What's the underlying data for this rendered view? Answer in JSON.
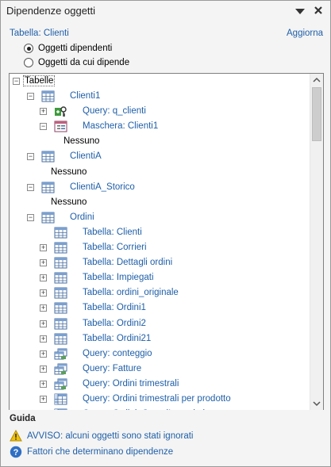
{
  "pane": {
    "title": "Dipendenze oggetti",
    "header_object": "Tabella: Clienti",
    "refresh_label": "Aggiorna"
  },
  "radios": [
    {
      "label": "Oggetti dipendenti",
      "selected": true
    },
    {
      "label": "Oggetti da cui dipende",
      "selected": false
    }
  ],
  "tree": {
    "root": "Tabelle",
    "items": [
      {
        "label": "Clienti1",
        "icon": "table-icon",
        "expander": "minus",
        "link": true
      },
      {
        "label": "Query: q_clienti",
        "icon": "query-key-icon",
        "expander": "plus",
        "link": true
      },
      {
        "label": "Maschera: Clienti1",
        "icon": "form-icon",
        "expander": "minus",
        "link": true
      },
      {
        "label": "Nessuno",
        "icon": "",
        "expander": "",
        "link": false
      },
      {
        "label": "ClientiA",
        "icon": "table-icon",
        "expander": "minus",
        "link": true
      },
      {
        "label": "Nessuno",
        "icon": "",
        "expander": "",
        "link": false
      },
      {
        "label": "ClientiA_Storico",
        "icon": "table-icon",
        "expander": "minus",
        "link": true
      },
      {
        "label": "Nessuno",
        "icon": "",
        "expander": "",
        "link": false
      },
      {
        "label": "Ordini",
        "icon": "table-icon",
        "expander": "minus",
        "link": true
      },
      {
        "label": "Tabella: Clienti",
        "icon": "table-icon",
        "expander": "",
        "link": true
      },
      {
        "label": "Tabella: Corrieri",
        "icon": "table-icon",
        "expander": "plus",
        "link": true
      },
      {
        "label": "Tabella: Dettagli ordini",
        "icon": "table-icon",
        "expander": "plus",
        "link": true
      },
      {
        "label": "Tabella: Impiegati",
        "icon": "table-icon",
        "expander": "plus",
        "link": true
      },
      {
        "label": "Tabella: ordini_originale",
        "icon": "table-icon",
        "expander": "plus",
        "link": true
      },
      {
        "label": "Tabella: Ordini1",
        "icon": "table-icon",
        "expander": "plus",
        "link": true
      },
      {
        "label": "Tabella: Ordini2",
        "icon": "table-icon",
        "expander": "plus",
        "link": true
      },
      {
        "label": "Tabella: Ordini21",
        "icon": "table-icon",
        "expander": "plus",
        "link": true
      },
      {
        "label": "Query: conteggio",
        "icon": "query-icon",
        "expander": "plus",
        "link": true
      },
      {
        "label": "Query: Fatture",
        "icon": "query-icon",
        "expander": "plus",
        "link": true
      },
      {
        "label": "Query: Ordini trimestrali",
        "icon": "query-icon",
        "expander": "plus",
        "link": true
      },
      {
        "label": "Query: Ordini trimestrali per prodotto",
        "icon": "crosstab-query-icon",
        "expander": "plus",
        "link": true
      },
      {
        "label": "Query: Ordini_CampiIncrociati",
        "icon": "crosstab-query-icon",
        "expander": "plus",
        "link": true
      }
    ]
  },
  "guida": {
    "heading": "Guida",
    "warning": "AVVISO: alcuni oggetti sono stati ignorati",
    "help": "Fattori che determinano dipendenze"
  },
  "colors": {
    "link": "#1f5fa8",
    "pane_bg": "#f4f4f4",
    "warning_icon": "#f2c200",
    "help_icon": "#2f6fc4"
  }
}
